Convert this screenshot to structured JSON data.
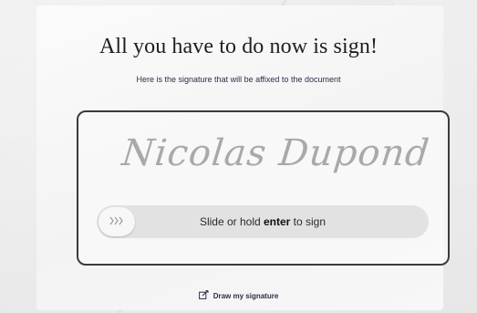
{
  "heading": {
    "title": "All you have to do now is sign!",
    "subtitle": "Here is the signature that will be affixed to the document"
  },
  "signature": {
    "name": "Nicolas Dupond"
  },
  "slider": {
    "text_before": "Slide or hold ",
    "key": "enter",
    "text_after": " to sign",
    "handle_icon": "chevrons-right-icon"
  },
  "draw_link": {
    "label": "Draw my signature",
    "icon": "edit-icon"
  },
  "colors": {
    "text_dark": "#1e1e1e",
    "navy": "#2b2f4a",
    "border": "#3b3b3b",
    "slider_track": "#e2e2e2",
    "signature_gray": "#a9a9a9"
  }
}
